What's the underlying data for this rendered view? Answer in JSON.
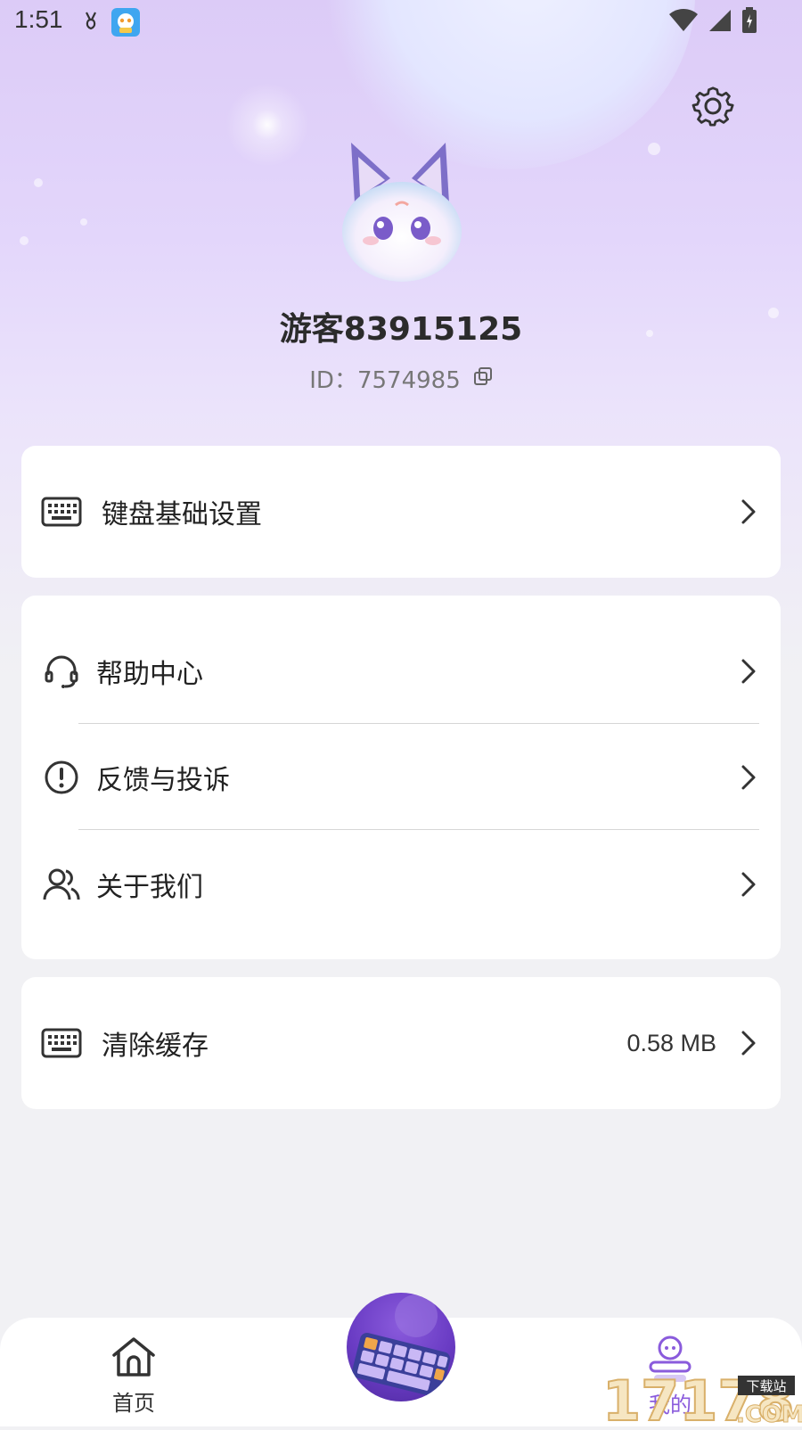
{
  "status_bar": {
    "time": "1:51"
  },
  "profile": {
    "name": "游客83915125",
    "id_label": "ID：",
    "id_value": "7574985"
  },
  "menu": {
    "keyboard_settings": "键盘基础设置",
    "help_center": "帮助中心",
    "feedback": "反馈与投诉",
    "about": "关于我们",
    "clear_cache": "清除缓存",
    "cache_size": "0.58 MB"
  },
  "bottom_nav": {
    "home": "首页",
    "mine": "我的"
  },
  "watermark": {
    "number": "17178",
    "suffix": ".COM",
    "tag": "下载站"
  },
  "colors": {
    "accent": "#8a5bdc",
    "header_bg": "#dccbf7",
    "page_bg": "#f1f1f4"
  }
}
